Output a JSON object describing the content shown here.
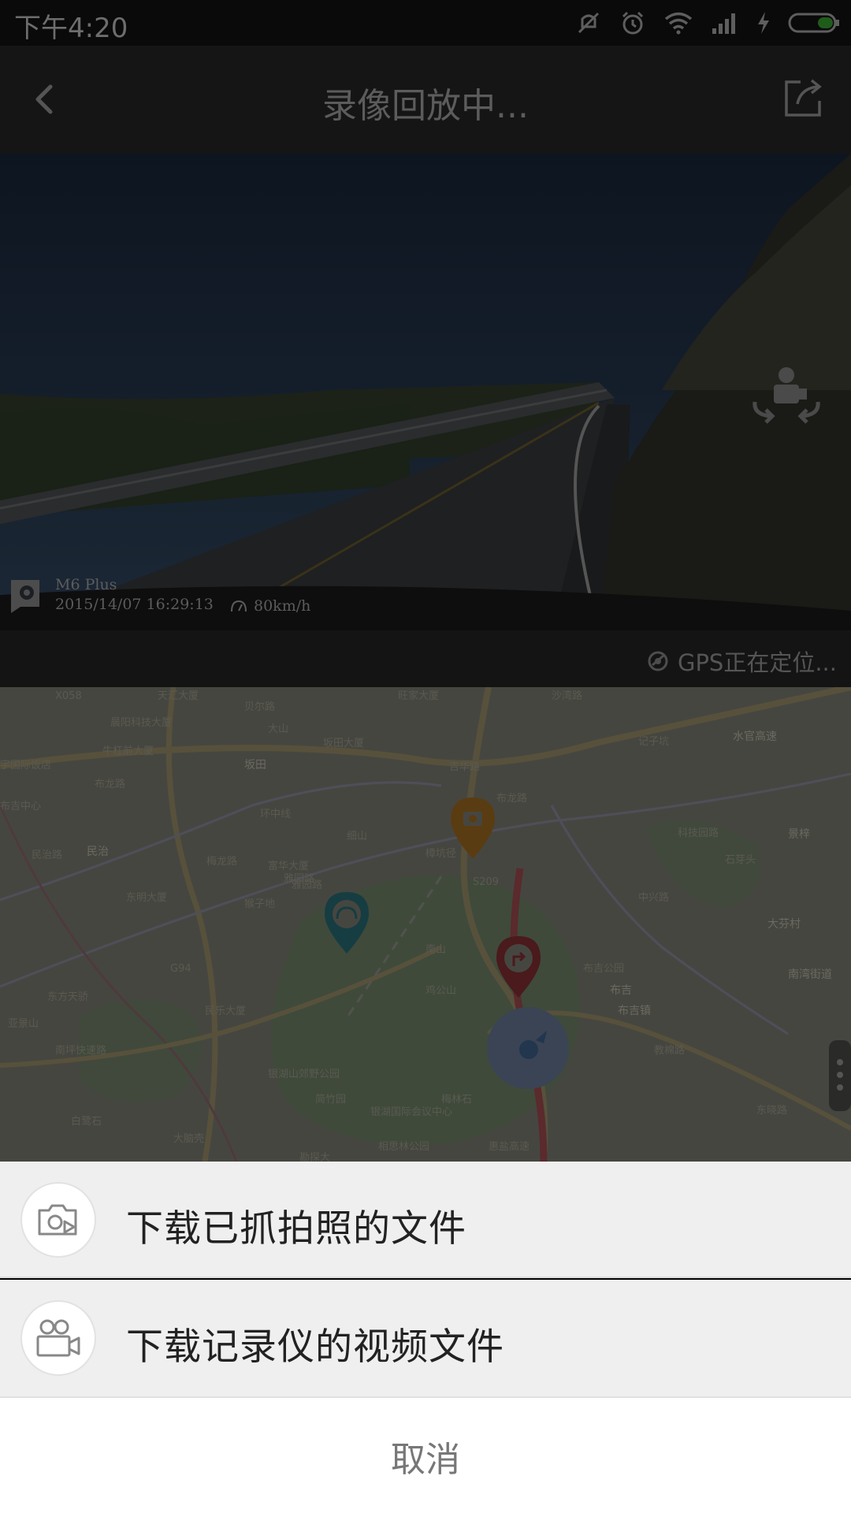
{
  "status_bar": {
    "time": "下午4:20"
  },
  "header": {
    "title": "录像回放中..."
  },
  "video": {
    "device_name": "M6 Plus",
    "timestamp": "2015/14/07 16:29:13",
    "speed": "80km/h"
  },
  "gps": {
    "status": "GPS正在定位..."
  },
  "map": {
    "labels": [
      "天汇大厦",
      "贝尔路",
      "旺家大厦",
      "晨阳科技大厦",
      "大山",
      "坂田大厦",
      "牛杠前大厦",
      "坂田",
      "宇国际饭店",
      "布龙路",
      "吉华路",
      "记子坑",
      "水官高速",
      "环中线",
      "细山",
      "布龙路",
      "布吉中心",
      "民治路",
      "民治",
      "富华大厦",
      "雅园路",
      "樟坑径",
      "石芽头",
      "梅龙路",
      "东明大厦",
      "猴子地",
      "科技园路",
      "景梓",
      "南湾街道",
      "东方天骄",
      "民乐大厦",
      "南山",
      "鸡公山",
      "布吉公园",
      "布吉",
      "布吉镇",
      "大芬村",
      "亚景山",
      "南坪快速路",
      "雅园路",
      "银湖山郊野公园",
      "简竹园",
      "梅林石",
      "教棉路",
      "东晓路",
      "白鹭石",
      "大脑壳",
      "银湖国际会议中心",
      "相思林公园",
      "勘探大",
      "惠盐高速",
      "中兴路",
      "沙湾路",
      "S209",
      "G94",
      "X058"
    ]
  },
  "sheet": {
    "options": [
      {
        "label": "下载已抓拍照的文件",
        "icon": "camera-play-icon"
      },
      {
        "label": "下载记录仪的视频文件",
        "icon": "video-camera-icon"
      }
    ],
    "cancel": "取消"
  }
}
